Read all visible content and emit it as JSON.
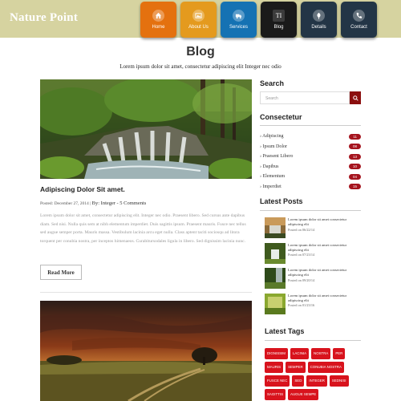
{
  "brand": {
    "logo": "Nature Point"
  },
  "nav": [
    {
      "label": "Home",
      "icon": "home-icon"
    },
    {
      "label": "About Us",
      "icon": "image-icon"
    },
    {
      "label": "Services",
      "icon": "truck-icon"
    },
    {
      "label": "Blog",
      "icon": "text-icon",
      "glyph": "TI"
    },
    {
      "label": "Details",
      "icon": "leaf-icon"
    },
    {
      "label": "Contact",
      "icon": "phone-icon"
    }
  ],
  "page": {
    "title": "Blog",
    "subtitle": "Lorem ipsum dolor sit amet, consectetur adipiscing elit Integer nec odio"
  },
  "post": {
    "title": "Adipiscing Dolor Sit amet.",
    "date": "Posted: December 27, 2014",
    "author": "By: Integer",
    "comments": "5 Comments",
    "excerpt": "Lorem ipsum dolor sit amet, consectetur adipiscing elit. Integer nec odio. Praesent libero. Sed cursus ante dapibus diam. Sed nisi. Nulla quis sem at nibh elementum imperdiet. Duis sagittis ipsum. Praesent mauris. Fusce nec tellus sed augue semper porta. Mauris massa. Vestibulum lacinia arcu eget nulla. Class aptent taciti sociosqu ad litora torquent per conubia nostra, per inceptos himenaeos. Curabitursodales ligula in libero. Sed dignissim lacinia nunc.",
    "read_more": "Read More"
  },
  "sidebar": {
    "search_title": "Search",
    "search_placeholder": "Search",
    "categories_title": "Consectetur",
    "categories": [
      {
        "label": "Adipiscing",
        "count": "11"
      },
      {
        "label": "Ipsum Dolor",
        "count": "08"
      },
      {
        "label": "Praesent Libero",
        "count": "13"
      },
      {
        "label": "Dapibus",
        "count": "10"
      },
      {
        "label": "Elementum",
        "count": "04"
      },
      {
        "label": "Imperdiet",
        "count": "15"
      }
    ],
    "latest_title": "Latest Posts",
    "latest_posts": [
      {
        "text": "Lorem ipsum dolor sit amet consectetur adipiscing elit",
        "date": "Posted on 06/22/14"
      },
      {
        "text": "Lorem ipsum dolor sit amet consectetur adipiscing elit",
        "date": "Posted on 07/23/14"
      },
      {
        "text": "Lorem ipsum dolor sit amet consectetur adipiscing elit",
        "date": "Posted on 09/20/14"
      },
      {
        "text": "Lorem ipsum dolor sit amet consectetur adipiscing elit",
        "date": "Posted on 01/23/16"
      }
    ],
    "tags_title": "Latest Tags",
    "tags": [
      "DIGNISSIM",
      "LACINIA",
      "NOSTRA",
      "PER",
      "MAURIS",
      "SEMPER",
      "CONUBIA NOSTRA",
      "FUSCE NEC",
      "SED",
      "INTEGER",
      "SEDNISI",
      "SAGITTIS",
      "AUGUE SEMPE"
    ]
  },
  "colors": {
    "header": "#d6d3a0",
    "accent": "#a5141e",
    "tag": "#d8131d"
  }
}
